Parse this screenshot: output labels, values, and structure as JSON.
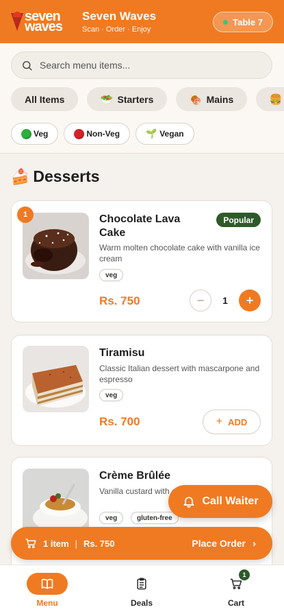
{
  "header": {
    "logo_line1": "seven",
    "logo_line2": "waves",
    "brand_name": "Seven Waves",
    "tagline": "Scan · Order · Enjoy",
    "table_label": "Table 7"
  },
  "search": {
    "placeholder": "Search menu items..."
  },
  "categories": [
    {
      "label": "All Items",
      "icon": ""
    },
    {
      "label": "Starters",
      "icon": "🥗"
    },
    {
      "label": "Mains",
      "icon": "🍖"
    },
    {
      "label": "",
      "icon": "🍔"
    }
  ],
  "diet_filters": [
    {
      "label": "Veg",
      "icon": "green-dot-icon"
    },
    {
      "label": "Non-Veg",
      "icon": "red-dot-icon"
    },
    {
      "label": "Vegan",
      "icon": "seedling-icon"
    }
  ],
  "section": {
    "icon": "🍰",
    "title": "Desserts"
  },
  "items": [
    {
      "name_line1": "Chocolate Lava",
      "name_line2": "Cake",
      "description": "Warm molten chocolate cake with vanilla ice cream",
      "tags": [
        "veg"
      ],
      "price": "Rs. 750",
      "badge": "Popular",
      "cart_count": "1",
      "quantity": "1"
    },
    {
      "name_line1": "Tiramisu",
      "description": "Classic Italian dessert with mascarpone and espresso",
      "tags": [
        "veg"
      ],
      "price": "Rs. 700",
      "add_label": "ADD"
    },
    {
      "name_line1": "Crème Brûlée",
      "description": "Vanilla custard with caramelized sugar crust",
      "tags": [
        "veg",
        "gluten-free"
      ]
    }
  ],
  "call_waiter": {
    "label": "Call Waiter"
  },
  "order_bar": {
    "count": "1 item",
    "separator": "|",
    "total": "Rs. 750",
    "action": "Place Order"
  },
  "bottom_nav": [
    {
      "label": "Menu",
      "icon": "book-icon",
      "active": true
    },
    {
      "label": "Deals",
      "icon": "clipboard-icon",
      "active": false
    },
    {
      "label": "Cart",
      "icon": "cart-icon",
      "active": false,
      "badge": "1"
    }
  ],
  "colors": {
    "accent": "#f07a22",
    "popular_badge": "#2e5a2a",
    "background": "#f5f1ec"
  }
}
